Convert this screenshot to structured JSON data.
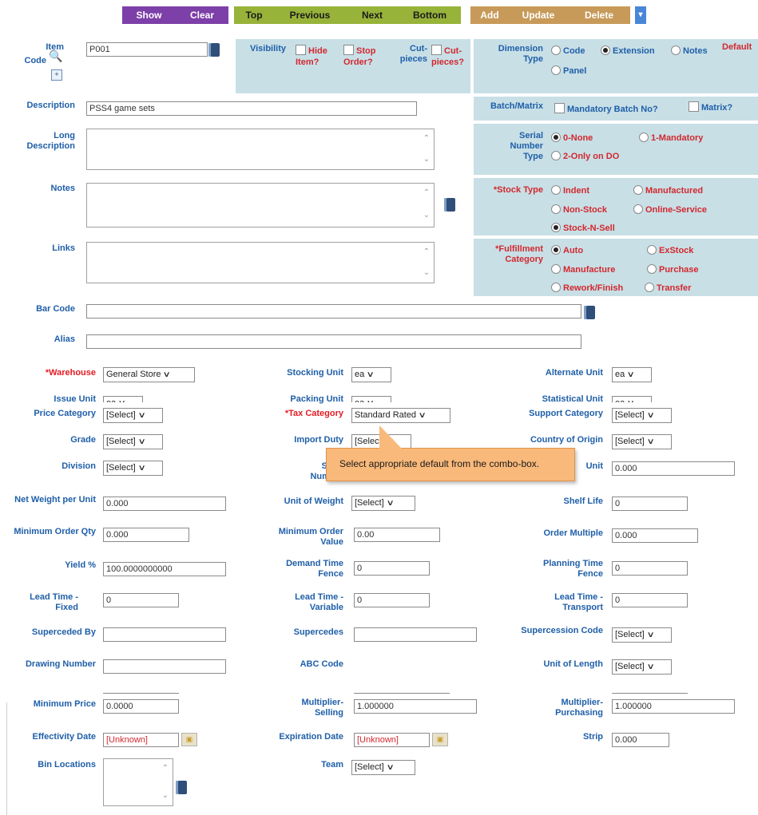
{
  "toolbar": {
    "show": "Show",
    "clear": "Clear",
    "top": "Top",
    "previous": "Previous",
    "next": "Next",
    "bottom": "Bottom",
    "add": "Add",
    "update": "Update",
    "delete": "Delete",
    "dropdown": "▾"
  },
  "item": {
    "label_top": "Item",
    "label_bottom": "Code",
    "value": "P001"
  },
  "visibility": {
    "label": "Visibility",
    "hide": "Hide Item?",
    "stop": "Stop Order?",
    "cut_pieces_label": "Cut-pieces",
    "cut_pieces": "Cut-pieces?"
  },
  "dimension": {
    "label": "Dimension Type",
    "default_label": "Default",
    "code": "Code",
    "extension": "Extension",
    "notes": "Notes",
    "panel": "Panel"
  },
  "description": {
    "label": "Description",
    "value": "PSS4 game sets"
  },
  "batch": {
    "label": "Batch/Matrix",
    "mandatory": "Mandatory Batch No?",
    "matrix": "Matrix?"
  },
  "long_description": {
    "label": "Long Description"
  },
  "serial": {
    "label": "Serial Number Type",
    "none": "0-None",
    "mandatory": "1-Mandatory",
    "only_do": "2-Only on DO"
  },
  "notes": {
    "label": "Notes"
  },
  "stock_type": {
    "label": "*Stock Type",
    "indent": "Indent",
    "manufactured": "Manufactured",
    "non_stock": "Non-Stock",
    "online": "Online-Service",
    "stock_n_sell": "Stock-N-Sell"
  },
  "links": {
    "label": "Links"
  },
  "fulfillment": {
    "label": "*Fulfillment Category",
    "auto": "Auto",
    "exstock": "ExStock",
    "manufacture": "Manufacture",
    "purchase": "Purchase",
    "rework": "Rework/Finish",
    "transfer": "Transfer"
  },
  "bar_code": {
    "label": "Bar Code"
  },
  "alias": {
    "label": "Alias"
  },
  "fields": {
    "warehouse": {
      "label": "*Warehouse",
      "value": "General Store"
    },
    "stocking_unit": {
      "label": "Stocking Unit",
      "value": "ea"
    },
    "alternate_unit": {
      "label": "Alternate Unit",
      "value": "ea"
    },
    "issue_unit": {
      "label": "Issue Unit",
      "value": "ea"
    },
    "packing_unit": {
      "label": "Packing Unit",
      "value": "ea"
    },
    "statistical_unit": {
      "label": "Statistical Unit",
      "value": "ea"
    },
    "price_category": {
      "label": "Price Category",
      "value": "[Select]"
    },
    "tax_category": {
      "label": "*Tax Category",
      "value": "Standard Rated"
    },
    "support_category": {
      "label": "Support Category",
      "value": "[Select]"
    },
    "grade": {
      "label": "Grade",
      "value": "[Select]"
    },
    "import_duty": {
      "label": "Import Duty",
      "value": "[Select]"
    },
    "country_of_origin": {
      "label": "Country of Origin",
      "value": "[Select]"
    },
    "division": {
      "label": "Division",
      "value": "[Select]"
    },
    "supplier_number": {
      "label_top": "Supp",
      "label_bottom": "Number"
    },
    "unit_right": {
      "label": "Unit",
      "value": "0.000"
    },
    "net_weight": {
      "label": "Net Weight per Unit",
      "value": "0.000"
    },
    "unit_of_weight": {
      "label": "Unit of Weight",
      "value": "[Select]"
    },
    "shelf_life": {
      "label": "Shelf Life",
      "value": "0"
    },
    "min_order_qty": {
      "label": "Minimum Order Qty",
      "value": "0.000"
    },
    "min_order_value": {
      "label": "Minimum Order Value",
      "value": "0.00"
    },
    "order_multiple": {
      "label": "Order Multiple",
      "value": "0.000"
    },
    "yield": {
      "label": "Yield %",
      "value": "100.0000000000"
    },
    "demand_time_fence": {
      "label": "Demand Time Fence",
      "value": "0"
    },
    "planning_time_fence": {
      "label": "Planning Time Fence",
      "value": "0"
    },
    "lead_time_fixed": {
      "label": "Lead Time - Fixed",
      "value": "0"
    },
    "lead_time_variable": {
      "label": "Lead Time - Variable",
      "value": "0"
    },
    "lead_time_transport": {
      "label": "Lead Time - Transport",
      "value": "0"
    },
    "superceded_by": {
      "label": "Superceded By",
      "value": ""
    },
    "supercedes": {
      "label": "Supercedes",
      "value": ""
    },
    "supercession_code": {
      "label": "Supercession Code",
      "value": "[Select]"
    },
    "drawing_number": {
      "label": "Drawing Number",
      "value": ""
    },
    "abc_code": {
      "label": "ABC Code"
    },
    "unit_of_length": {
      "label": "Unit of Length",
      "value": "[Select]"
    },
    "minimum_price": {
      "label": "Minimum Price",
      "value": "0.0000"
    },
    "multiplier_selling": {
      "label": "Multiplier-Selling",
      "value": "1.000000"
    },
    "multiplier_purchasing": {
      "label": "Multiplier-Purchasing",
      "value": "1.000000"
    },
    "effectivity_date": {
      "label": "Effectivity Date",
      "value": "[Unknown]"
    },
    "expiration_date": {
      "label": "Expiration Date",
      "value": "[Unknown]"
    },
    "strip": {
      "label": "Strip",
      "value": "0.000"
    },
    "bin_locations": {
      "label": "Bin Locations"
    },
    "team": {
      "label": "Team",
      "value": "[Select]"
    }
  },
  "tooltip": {
    "text": "Select appropriate default from the combo-box."
  }
}
